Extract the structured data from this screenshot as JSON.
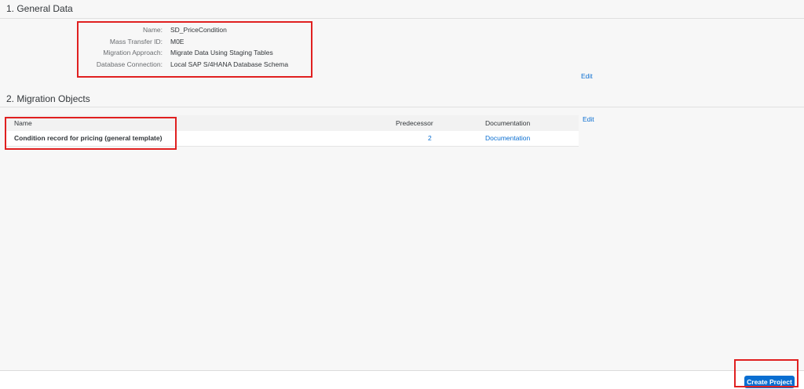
{
  "general_data": {
    "title": "1. General Data",
    "fields": [
      {
        "label": "Name:",
        "value": "SD_PriceCondition"
      },
      {
        "label": "Mass Transfer ID:",
        "value": "M0E"
      },
      {
        "label": "Migration Approach:",
        "value": "Migrate Data Using Staging Tables"
      },
      {
        "label": "Database Connection:",
        "value": "Local SAP S/4HANA Database Schema"
      }
    ],
    "edit_label": "Edit"
  },
  "migration_objects": {
    "title": "2. Migration Objects",
    "edit_label": "Edit",
    "columns": {
      "name": "Name",
      "predecessor": "Predecessor",
      "documentation": "Documentation"
    },
    "rows": [
      {
        "name": "Condition record for pricing (general template)",
        "predecessor": "2",
        "documentation": "Documentation"
      }
    ]
  },
  "footer": {
    "create_project_label": "Create Project"
  },
  "colors": {
    "link": "#0a6ed1",
    "primary_button": "#0a6ed1",
    "annotation_box": "#e02020"
  }
}
